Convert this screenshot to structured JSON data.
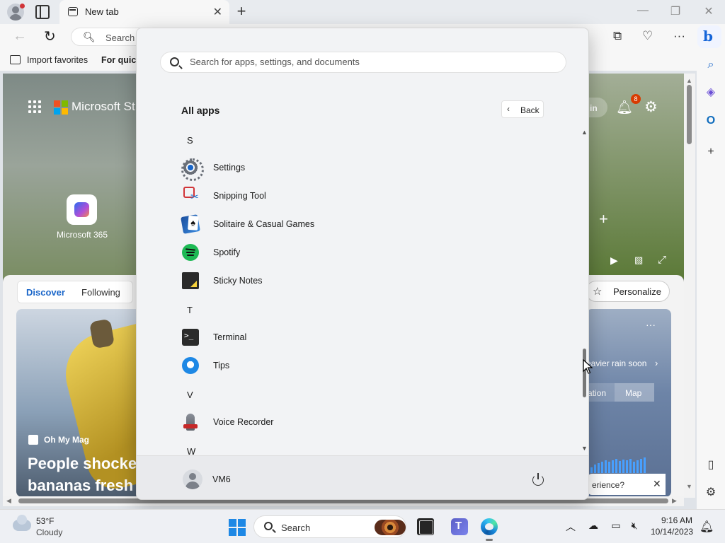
{
  "browser": {
    "tab_title": "New tab",
    "address_placeholder": "Search",
    "favorites": {
      "import_label": "Import favorites",
      "quick_label": "For quick"
    }
  },
  "newtab_page": {
    "brand_title": "Microsoft Start",
    "quick_link_label": "Microsoft 365",
    "sign_in_label": "in",
    "notification_count": "8",
    "feed_tabs": [
      "Discover",
      "Following"
    ],
    "personalize_label": "Personalize",
    "story": {
      "source": "Oh My Mag",
      "headline_lines": [
        "People shocke",
        "bananas fresh"
      ]
    },
    "weather_card": {
      "alert_text": "eavier rain soon",
      "segment_left": "ation",
      "segment_right": "Map"
    },
    "feedback_text": "erience?"
  },
  "start_menu": {
    "search_placeholder": "Search for apps, settings, and documents",
    "section_title": "All apps",
    "back_label": "Back",
    "letters": [
      "S",
      "T",
      "V",
      "W"
    ],
    "apps": [
      {
        "name": "Settings",
        "icon": "settings-gear-icon"
      },
      {
        "name": "Snipping Tool",
        "icon": "snipping-tool-icon"
      },
      {
        "name": "Solitaire & Casual Games",
        "icon": "solitaire-cards-icon"
      },
      {
        "name": "Spotify",
        "icon": "spotify-icon"
      },
      {
        "name": "Sticky Notes",
        "icon": "sticky-notes-icon"
      },
      {
        "name": "Terminal",
        "icon": "terminal-icon"
      },
      {
        "name": "Tips",
        "icon": "tips-lightbulb-icon"
      },
      {
        "name": "Voice Recorder",
        "icon": "microphone-icon"
      }
    ],
    "user_name": "VM6"
  },
  "taskbar": {
    "weather_temp": "53°F",
    "weather_condition": "Cloudy",
    "search_label": "Search",
    "time": "9:16 AM",
    "date": "10/14/2023"
  },
  "colors": {
    "accent": "#1a66c9",
    "start_menu_bg": "#f2f3f5",
    "badge": "#d83b01"
  }
}
